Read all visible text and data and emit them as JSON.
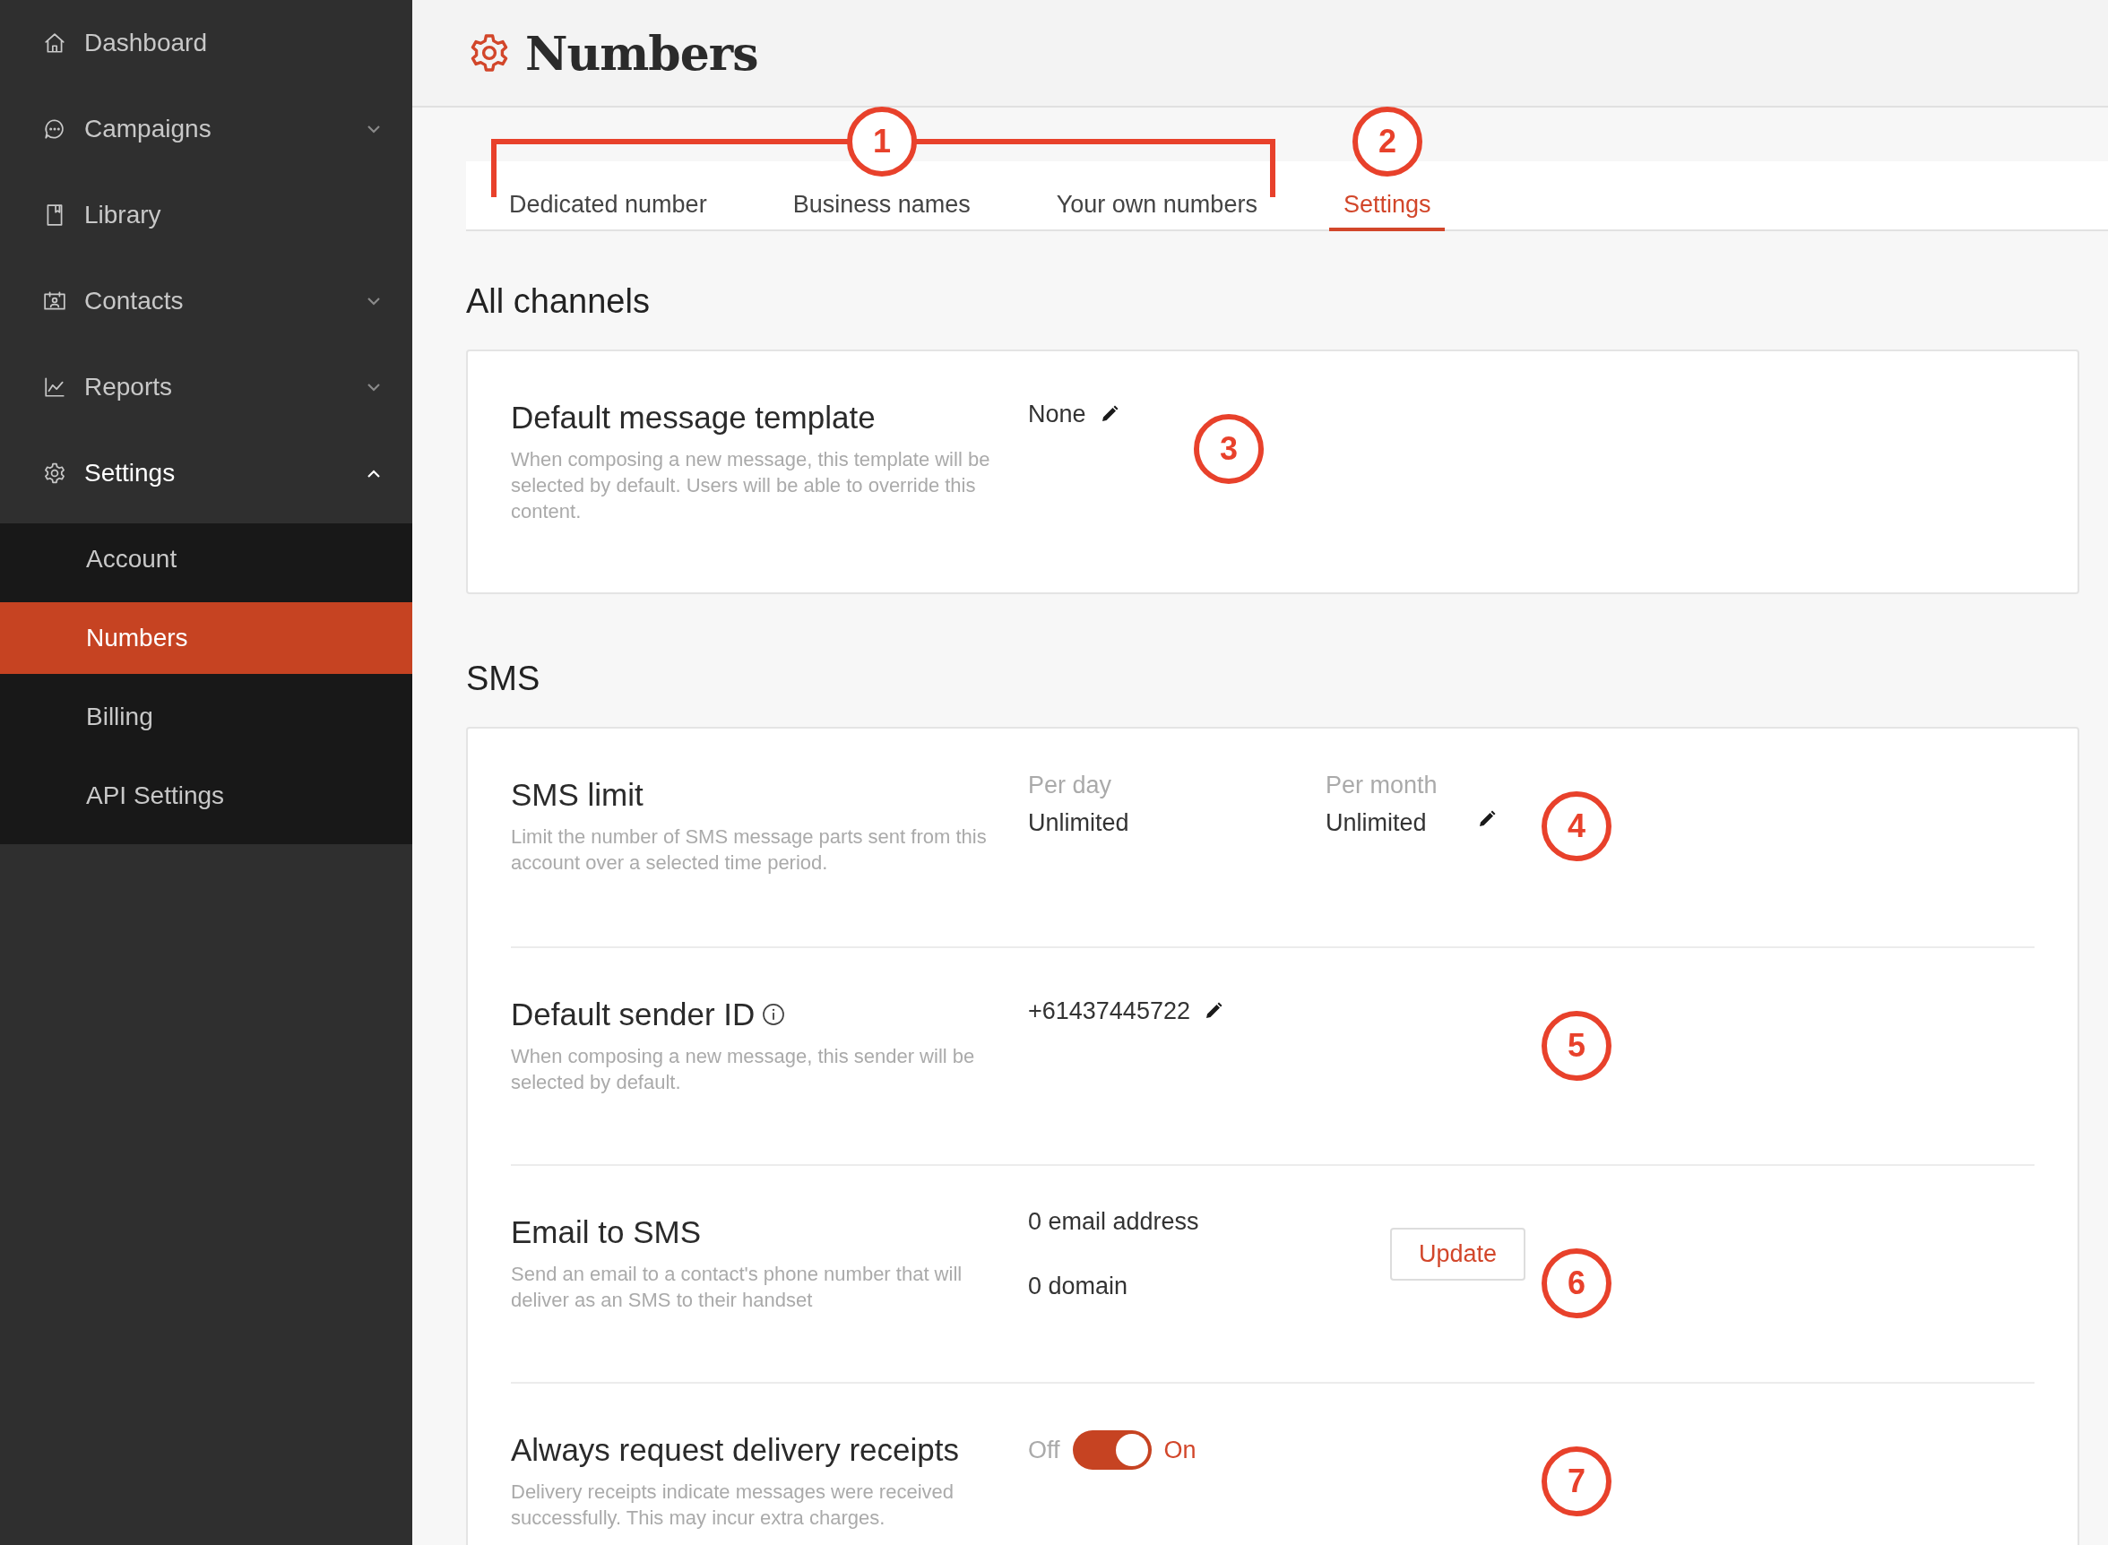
{
  "sidebar": {
    "items": [
      {
        "label": "Dashboard",
        "selected": false
      },
      {
        "label": "Campaigns",
        "expanded": false,
        "selected": false
      },
      {
        "label": "Library",
        "selected": false
      },
      {
        "label": "Contacts",
        "expanded": false,
        "selected": false
      },
      {
        "label": "Reports",
        "expanded": false,
        "selected": false
      },
      {
        "label": "Settings",
        "expanded": true,
        "selected": true,
        "children": [
          {
            "label": "Account",
            "selected": false
          },
          {
            "label": "Numbers",
            "selected": true
          },
          {
            "label": "Billing",
            "selected": false
          },
          {
            "label": "API Settings",
            "selected": false
          }
        ]
      }
    ]
  },
  "page": {
    "title": "Numbers"
  },
  "tabs": {
    "items": [
      {
        "label": "Dedicated number",
        "selected": false
      },
      {
        "label": "Business names",
        "selected": false
      },
      {
        "label": "Your own numbers",
        "selected": false
      },
      {
        "label": "Settings",
        "selected": true
      }
    ],
    "group_callout": "1",
    "selected_callout": "2"
  },
  "sections": [
    {
      "heading": "All channels",
      "rows": [
        {
          "kind": "edit",
          "title": "Default message template",
          "info": false,
          "description": "When composing a new message, this template will be selected by default. Users will be able to override this content.",
          "value": "None",
          "callout": "3"
        }
      ]
    },
    {
      "heading": "SMS",
      "rows": [
        {
          "kind": "limits",
          "title": "SMS limit",
          "description": "Limit the number of SMS message parts sent from this account over a selected time period.",
          "limits": [
            {
              "label": "Per day",
              "value": "Unlimited"
            },
            {
              "label": "Per month",
              "value": "Unlimited"
            }
          ],
          "callout": "4"
        },
        {
          "kind": "edit",
          "title": "Default sender ID",
          "info": true,
          "description": "When composing a new message, this sender will be selected by default.",
          "value": "+61437445722",
          "callout": "5"
        },
        {
          "kind": "button",
          "title": "Email to SMS",
          "description": "Send an email to a contact's phone number that will deliver as an SMS to their handset",
          "values": [
            "0 email address",
            "0 domain"
          ],
          "button": "Update",
          "callout": "6"
        },
        {
          "kind": "toggle",
          "title": "Always request delivery receipts",
          "description": "Delivery receipts indicate messages were received successfully. This may incur extra charges.",
          "off_label": "Off",
          "on_label": "On",
          "on": true,
          "callout": "7"
        }
      ]
    }
  ]
}
